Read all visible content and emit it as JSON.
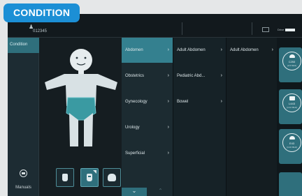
{
  "header_badge": "CONDITION",
  "topbar": {
    "patient_id": "012345",
    "drive_label": "Drive"
  },
  "leftnav": {
    "condition_label": "Condition",
    "manuals_label": "Manuals"
  },
  "probe_buttons": [
    {
      "icon": "linear-probe-icon",
      "selected": false
    },
    {
      "icon": "convex-probe-icon",
      "selected": true
    },
    {
      "icon": "curved-probe-icon",
      "selected": false
    }
  ],
  "menu": {
    "col1": [
      {
        "label": "Abdomen",
        "selected": true
      },
      {
        "label": "Obstetrics",
        "selected": false
      },
      {
        "label": "Gynecology",
        "selected": false
      },
      {
        "label": "Urology",
        "selected": false
      },
      {
        "label": "Superficial",
        "selected": false
      }
    ],
    "col2": [
      {
        "label": "Adult Abdomen",
        "selected": false
      },
      {
        "label": "Pediatric Abd...",
        "selected": false
      },
      {
        "label": "Bowel",
        "selected": false
      }
    ],
    "col3": [
      {
        "label": "Adult Abdomen",
        "selected": false
      }
    ]
  },
  "presets": [
    {
      "code": "C253",
      "freq": "(2-5 MHz)",
      "icon": "convex-probe-icon"
    },
    {
      "code": "L443",
      "freq": "(4-12 MHz)",
      "icon": "linear-probe-icon"
    },
    {
      "code": "E43",
      "freq": "(4-10 MHz)",
      "icon": "curved-probe-icon"
    }
  ],
  "colors": {
    "accent": "#1c8fd5",
    "teal_selected": "#34808f",
    "body_highlight": "#3a9aa2"
  }
}
